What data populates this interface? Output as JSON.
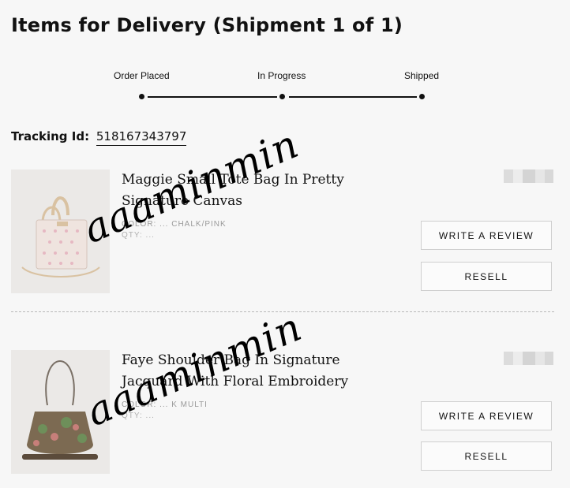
{
  "page": {
    "title": "Items for Delivery (Shipment 1 of 1)"
  },
  "tracker": {
    "steps": [
      "Order Placed",
      "In Progress",
      "Shipped"
    ]
  },
  "tracking": {
    "label": "Tracking Id:",
    "number": "518167343797"
  },
  "items": [
    {
      "name": "Maggie Small Tote Bag In Pretty Signature Canvas",
      "color": "COLOR: ... CHALK/PINK",
      "qty": "QTY: ...",
      "review_label": "WRITE A REVIEW",
      "resell_label": "RESELL"
    },
    {
      "name": "Faye Shoulder Bag In Signature Jacquard With Floral Embroidery",
      "color": "COLOR: ... K MULTI",
      "qty": "QTY: ...",
      "review_label": "WRITE A REVIEW",
      "resell_label": "RESELL"
    }
  ],
  "watermark": {
    "text": "aaaminmin"
  }
}
